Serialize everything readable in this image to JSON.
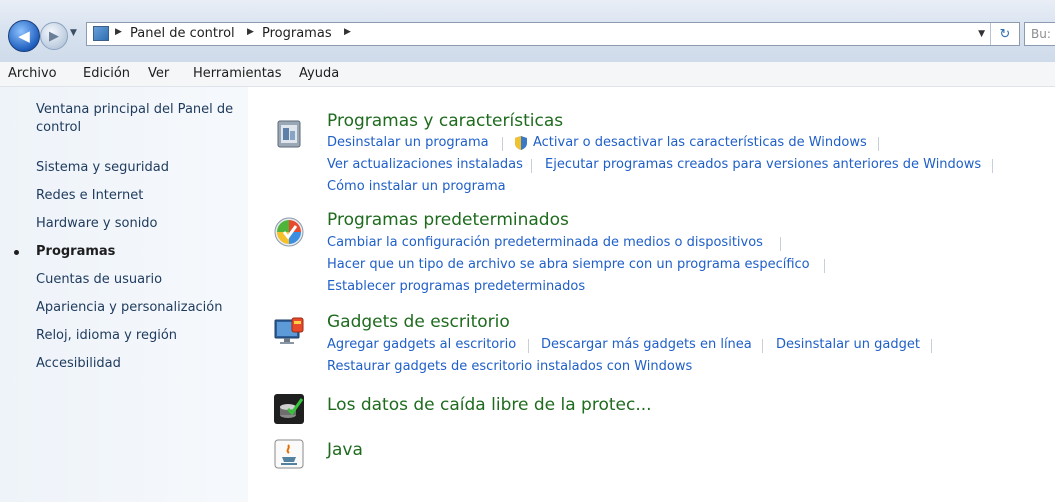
{
  "address": {
    "breadcrumbs": [
      "Panel de control",
      "Programas"
    ],
    "search_placeholder": "Bu:"
  },
  "menu": [
    "Archivo",
    "Edición",
    "Ver",
    "Herramientas",
    "Ayuda"
  ],
  "sidebar": {
    "home": "Ventana principal del Panel de control",
    "items": [
      {
        "label": "Sistema y seguridad",
        "current": false
      },
      {
        "label": "Redes e Internet",
        "current": false
      },
      {
        "label": "Hardware y sonido",
        "current": false
      },
      {
        "label": "Programas",
        "current": true
      },
      {
        "label": "Cuentas de usuario",
        "current": false
      },
      {
        "label": "Apariencia y personalización",
        "current": false
      },
      {
        "label": "Reloj, idioma y región",
        "current": false
      },
      {
        "label": "Accesibilidad",
        "current": false
      }
    ]
  },
  "categories": [
    {
      "title": "Programas y características",
      "icon": "programs-features-icon",
      "links": [
        "Desinstalar un programa",
        "Activar o desactivar las características de Windows",
        "Ver actualizaciones instaladas",
        "Ejecutar programas creados para versiones anteriores de Windows",
        "Cómo instalar un programa"
      ]
    },
    {
      "title": "Programas predeterminados",
      "icon": "default-programs-icon",
      "links": [
        "Cambiar la configuración predeterminada de medios o dispositivos",
        "Hacer que un tipo de archivo se abra siempre con un programa específico",
        "Establecer programas predeterminados"
      ]
    },
    {
      "title": "Gadgets de escritorio",
      "icon": "desktop-gadgets-icon",
      "links": [
        "Agregar gadgets al escritorio",
        "Descargar más gadgets en línea",
        "Desinstalar un gadget",
        "Restaurar gadgets de escritorio instalados con Windows"
      ]
    },
    {
      "title": "Los datos de caída libre de la protec...",
      "icon": "freefall-protection-icon",
      "links": []
    },
    {
      "title": "Java",
      "icon": "java-icon",
      "links": []
    }
  ]
}
